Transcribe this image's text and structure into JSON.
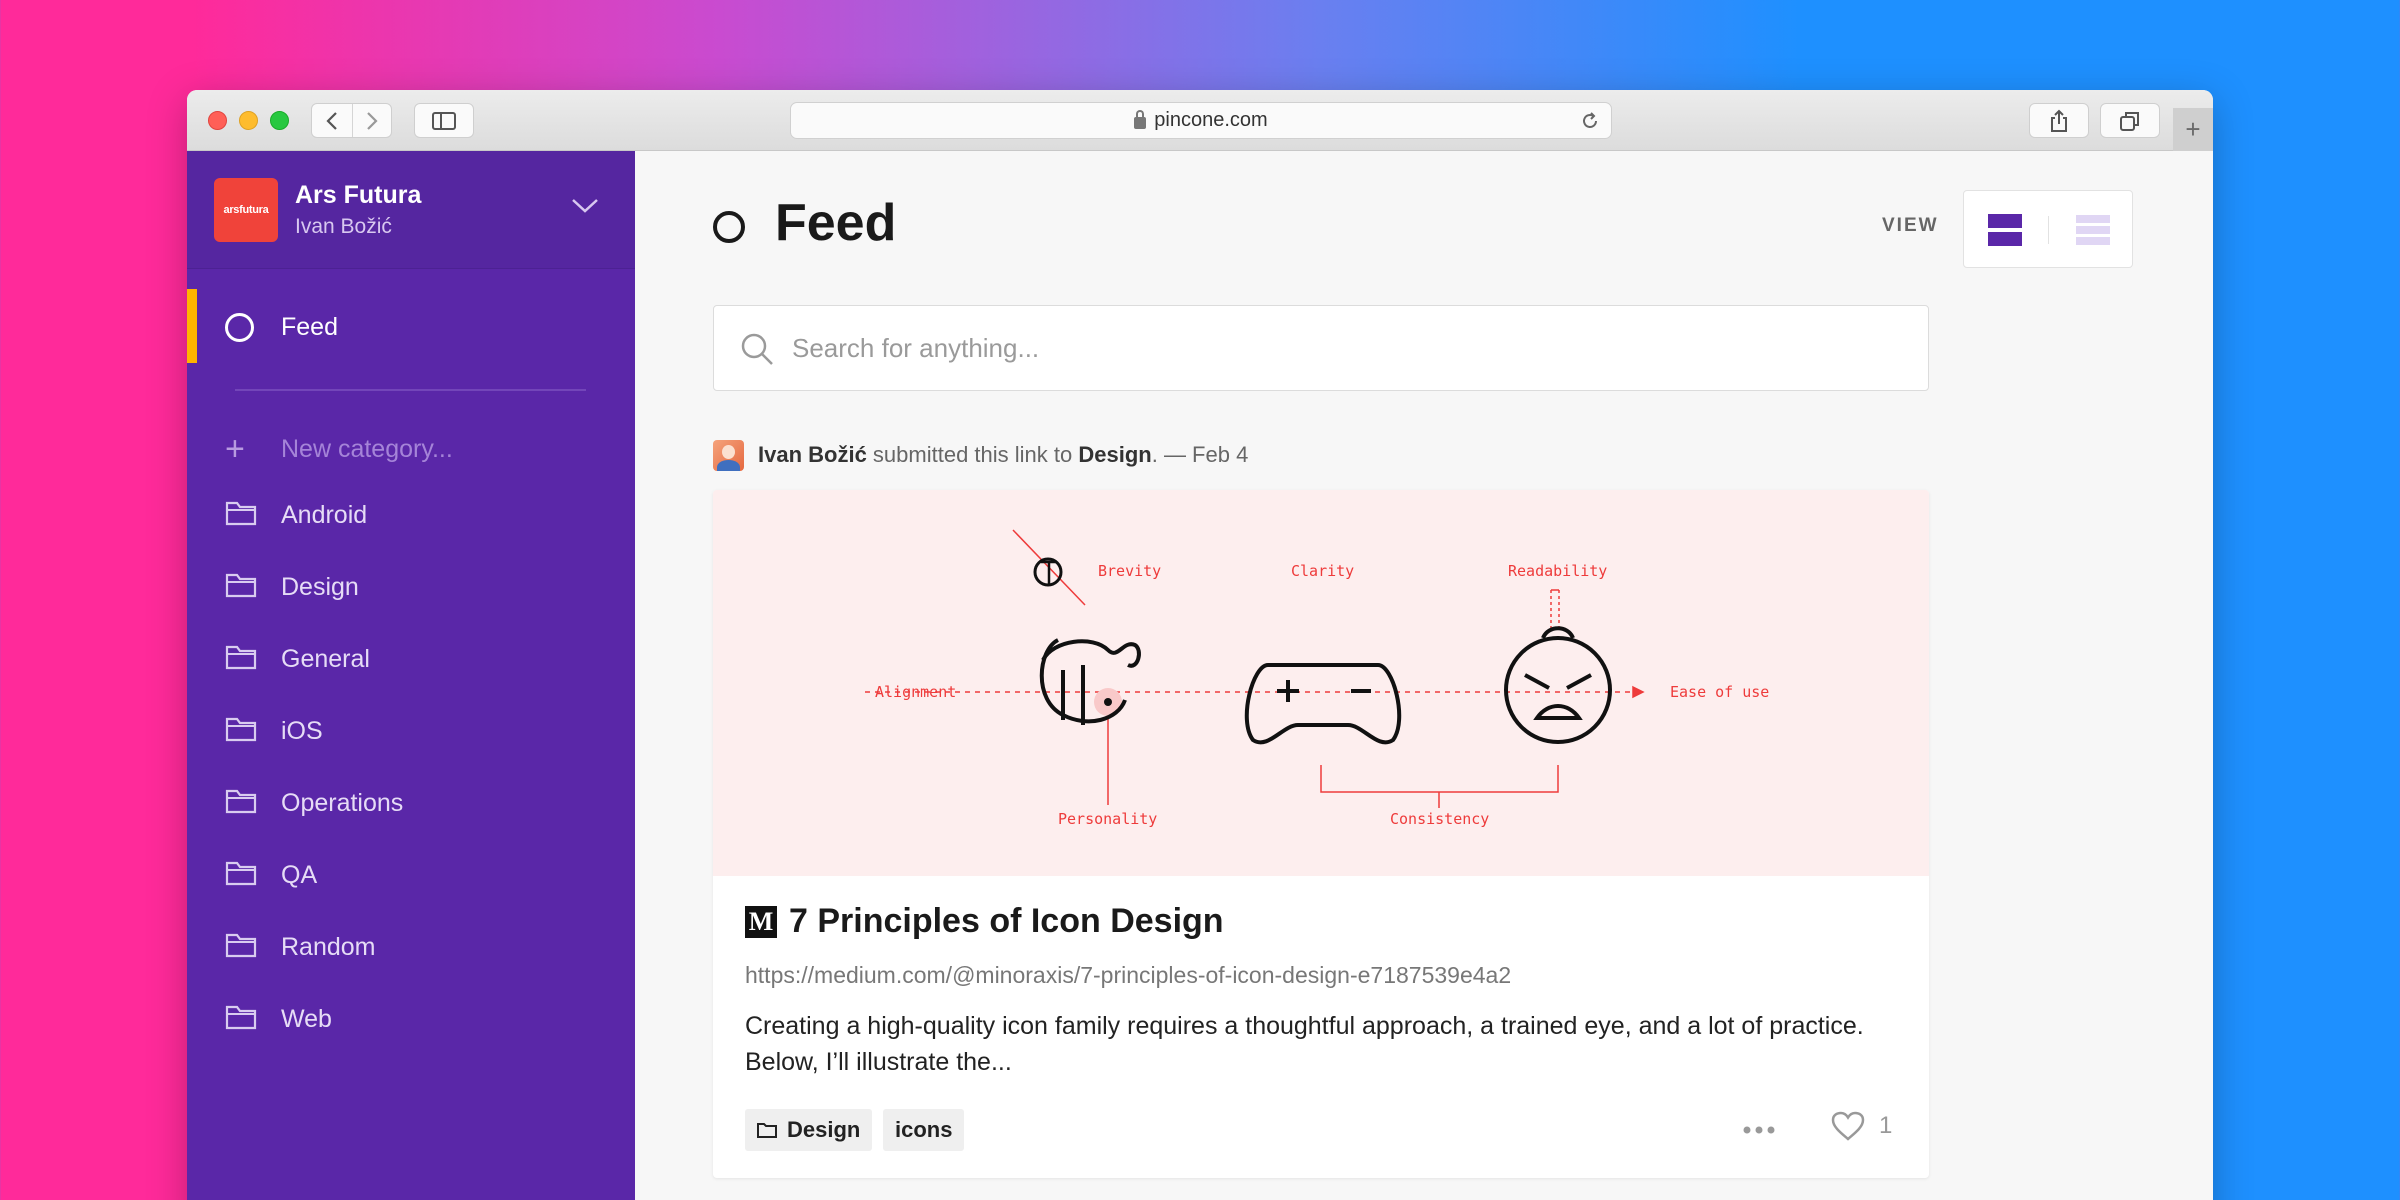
{
  "browser": {
    "url": "pincone.com"
  },
  "sidebar": {
    "org_logo_text": "arsfutura",
    "org_name": "Ars Futura",
    "user_name": "Ivan Božić",
    "feed_label": "Feed",
    "new_category_placeholder": "New category...",
    "categories": [
      "Android",
      "Design",
      "General",
      "iOS",
      "Operations",
      "QA",
      "Random",
      "Web"
    ]
  },
  "main": {
    "title": "Feed",
    "view_label": "VIEW",
    "search_placeholder": "Search for anything..."
  },
  "post": {
    "author": "Ivan Božić",
    "action_text": " submitted this link to ",
    "category": "Design",
    "date_text": ". — Feb 4",
    "image_labels": {
      "brevity": "Brevity",
      "clarity": "Clarity",
      "readability": "Readability",
      "alignment": "Alignment",
      "ease": "Ease of use",
      "personality": "Personality",
      "consistency": "Consistency"
    },
    "source_logo": "M",
    "title": "7 Principles of Icon Design",
    "url": "https://medium.com/@minoraxis/7-principles-of-icon-design-e7187539e4a2",
    "description": "Creating a high-quality icon family requires a thoughtful approach, a trained eye, and a lot of practice. Below, I’ll illustrate the...",
    "tags": [
      "Design",
      "icons"
    ],
    "like_count": "1"
  },
  "colors": {
    "sidebar": "#5a27a8",
    "accent_marker": "#ffb400",
    "diagram_red": "#ee3b3b"
  }
}
